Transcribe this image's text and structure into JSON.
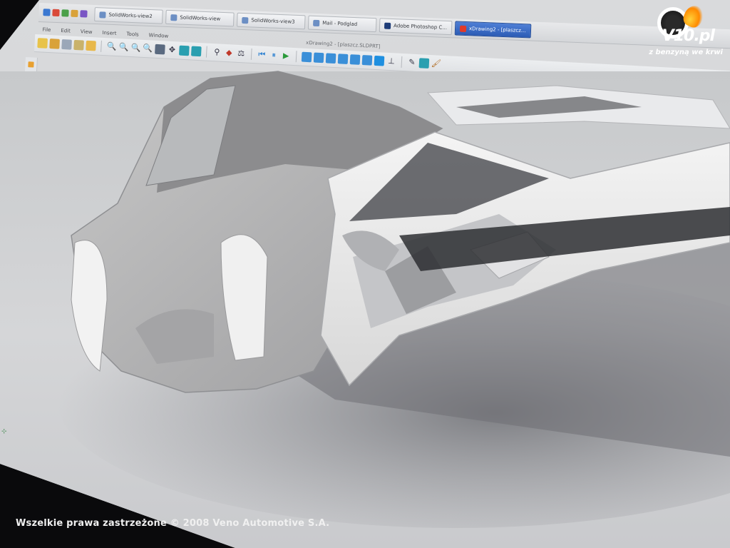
{
  "taskbar": {
    "tasks": [
      {
        "label": "SolidWorks-view2"
      },
      {
        "label": "SolidWorks-view"
      },
      {
        "label": "SolidWorks-view3"
      },
      {
        "label": "Mail - Podglad"
      },
      {
        "label": "Adobe Photoshop C..."
      },
      {
        "label": "xDrawing2 - [plaszcz..."
      }
    ],
    "active_index": 5
  },
  "app": {
    "menu": [
      "File",
      "Edit",
      "View",
      "Insert",
      "Tools",
      "Window"
    ],
    "document_title": "xDrawing2 - [plaszcz.SLDPRT]"
  },
  "watermark": {
    "logo_text": "V10.pl",
    "tagline": "z benzyną we krwi"
  },
  "footer": {
    "copyright": "Wszelkie prawa zastrzeżone © 2008 Veno Automotive S.A."
  },
  "colors": {
    "active_task": "#2c5cb5",
    "model_surface": "#e6e6e6",
    "background": "#d2d4d6",
    "flame": "#ff8a00"
  },
  "icons": {
    "triad": "axis-triad-icon",
    "logo": "tire-logo-icon",
    "flame": "flame-icon"
  }
}
